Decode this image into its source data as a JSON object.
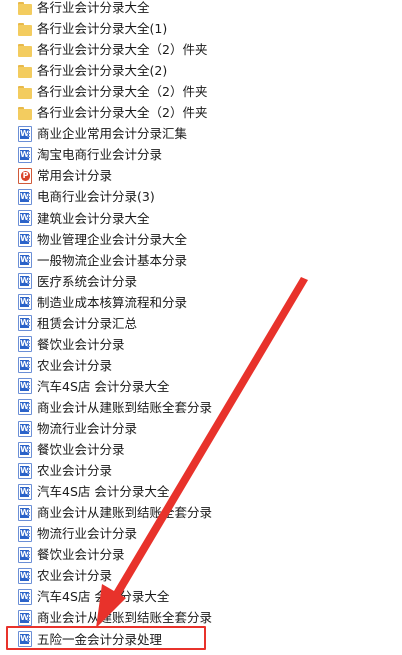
{
  "files": [
    {
      "type": "folder",
      "name": "各行业会计分录大全"
    },
    {
      "type": "folder",
      "name": "各行业会计分录大全(1)"
    },
    {
      "type": "folder",
      "name": "各行业会计分录大全（2）件夹"
    },
    {
      "type": "folder",
      "name": "各行业会计分录大全(2)"
    },
    {
      "type": "folder",
      "name": "各行业会计分录大全（2）件夹"
    },
    {
      "type": "folder",
      "name": "各行业会计分录大全（2）件夹"
    },
    {
      "type": "word",
      "name": "商业企业常用会计分录汇集"
    },
    {
      "type": "word",
      "name": "淘宝电商行业会计分录"
    },
    {
      "type": "pdf",
      "name": "常用会计分录"
    },
    {
      "type": "word",
      "name": "电商行业会计分录(3)"
    },
    {
      "type": "word",
      "name": "建筑业会计分录大全"
    },
    {
      "type": "word",
      "name": "物业管理企业会计分录大全"
    },
    {
      "type": "word",
      "name": "一般物流企业会计基本分录"
    },
    {
      "type": "word",
      "name": "医疗系统会计分录"
    },
    {
      "type": "word",
      "name": "制造业成本核算流程和分录"
    },
    {
      "type": "word",
      "name": "租赁会计分录汇总"
    },
    {
      "type": "word",
      "name": "餐饮业会计分录"
    },
    {
      "type": "word",
      "name": "农业会计分录"
    },
    {
      "type": "word",
      "name": "汽车4S店 会计分录大全"
    },
    {
      "type": "word",
      "name": "商业会计从建账到结账全套分录"
    },
    {
      "type": "word",
      "name": "物流行业会计分录"
    },
    {
      "type": "word",
      "name": "餐饮业会计分录"
    },
    {
      "type": "word",
      "name": "农业会计分录"
    },
    {
      "type": "word",
      "name": "汽车4S店 会计分录大全"
    },
    {
      "type": "word",
      "name": "商业会计从建账到结账全套分录"
    },
    {
      "type": "word",
      "name": "物流行业会计分录"
    },
    {
      "type": "word",
      "name": "餐饮业会计分录"
    },
    {
      "type": "word",
      "name": "农业会计分录"
    },
    {
      "type": "word",
      "name": "汽车4S店 会计分录大全"
    },
    {
      "type": "word",
      "name": "商业会计从建账到结账全套分录"
    },
    {
      "type": "word",
      "name": "五险一金会计分录处理"
    }
  ],
  "annotation": {
    "color": "#e8322b"
  }
}
